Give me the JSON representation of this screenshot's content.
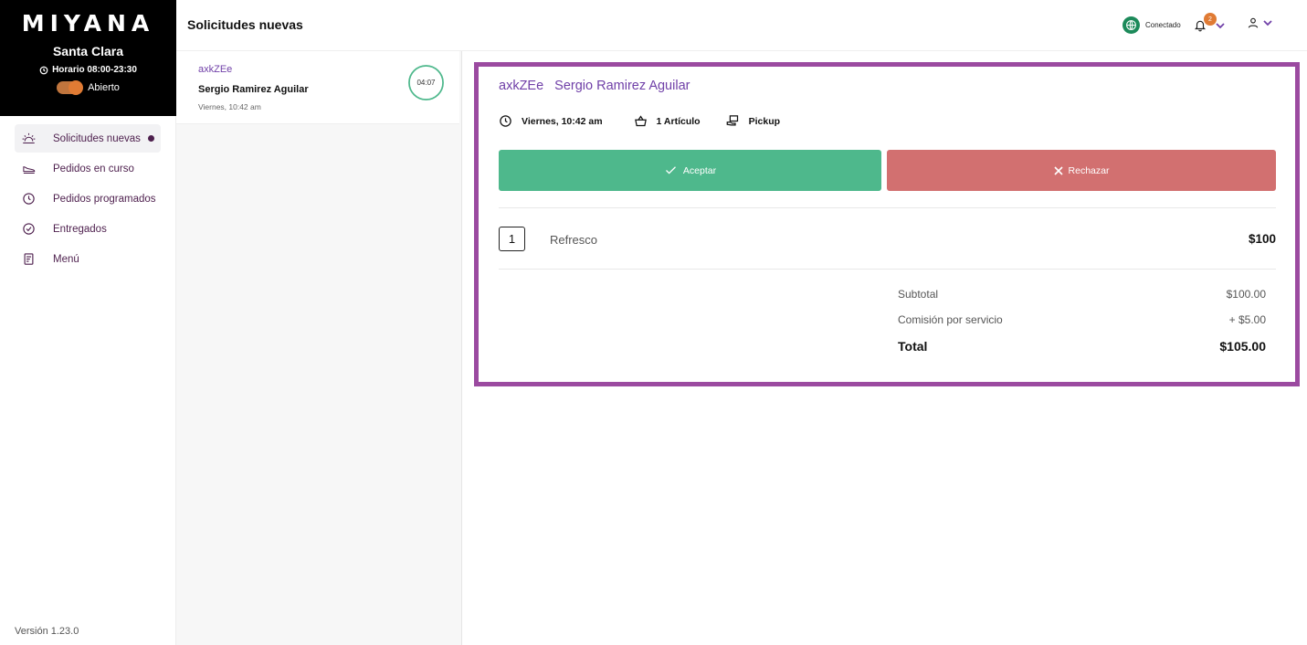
{
  "sidebar": {
    "logo": "MIYANA",
    "store_name": "Santa Clara",
    "hours": "Horario 08:00-23:30",
    "open_label": "Abierto",
    "items": [
      {
        "label": "Solicitudes nuevas",
        "icon": "sunrise-icon",
        "active": true
      },
      {
        "label": "Pedidos en curso",
        "icon": "shoe-icon"
      },
      {
        "label": "Pedidos programados",
        "icon": "clock-icon"
      },
      {
        "label": "Entregados",
        "icon": "check-circle-icon"
      },
      {
        "label": "Menú",
        "icon": "menu-book-icon"
      }
    ],
    "version": "Versión 1.23.0"
  },
  "header": {
    "title": "Solicitudes nuevas",
    "status": "Conectado",
    "notifications": "2"
  },
  "orders": [
    {
      "code": "axkZEe",
      "customer": "Sergio Ramirez Aguilar",
      "time": "Viernes, 10:42 am",
      "timer": "04:07"
    }
  ],
  "detail": {
    "code": "axkZEe",
    "customer": "Sergio Ramirez Aguilar",
    "datetime": "Viernes, 10:42 am",
    "articles": "1 Artículo",
    "delivery": "Pickup",
    "accept_label": "Aceptar",
    "reject_label": "Rechazar",
    "items": [
      {
        "qty": "1",
        "name": "Refresco",
        "price": "$100"
      }
    ],
    "subtotal_label": "Subtotal",
    "subtotal": "$100.00",
    "fee_label": "Comisión por servicio",
    "fee": "+ $5.00",
    "total_label": "Total",
    "total": "$105.00"
  },
  "colors": {
    "accent": "#7040a8",
    "border": "#9b4aa0",
    "accept": "#4eb88c",
    "reject": "#d27070",
    "toggle": "#e07b34"
  }
}
